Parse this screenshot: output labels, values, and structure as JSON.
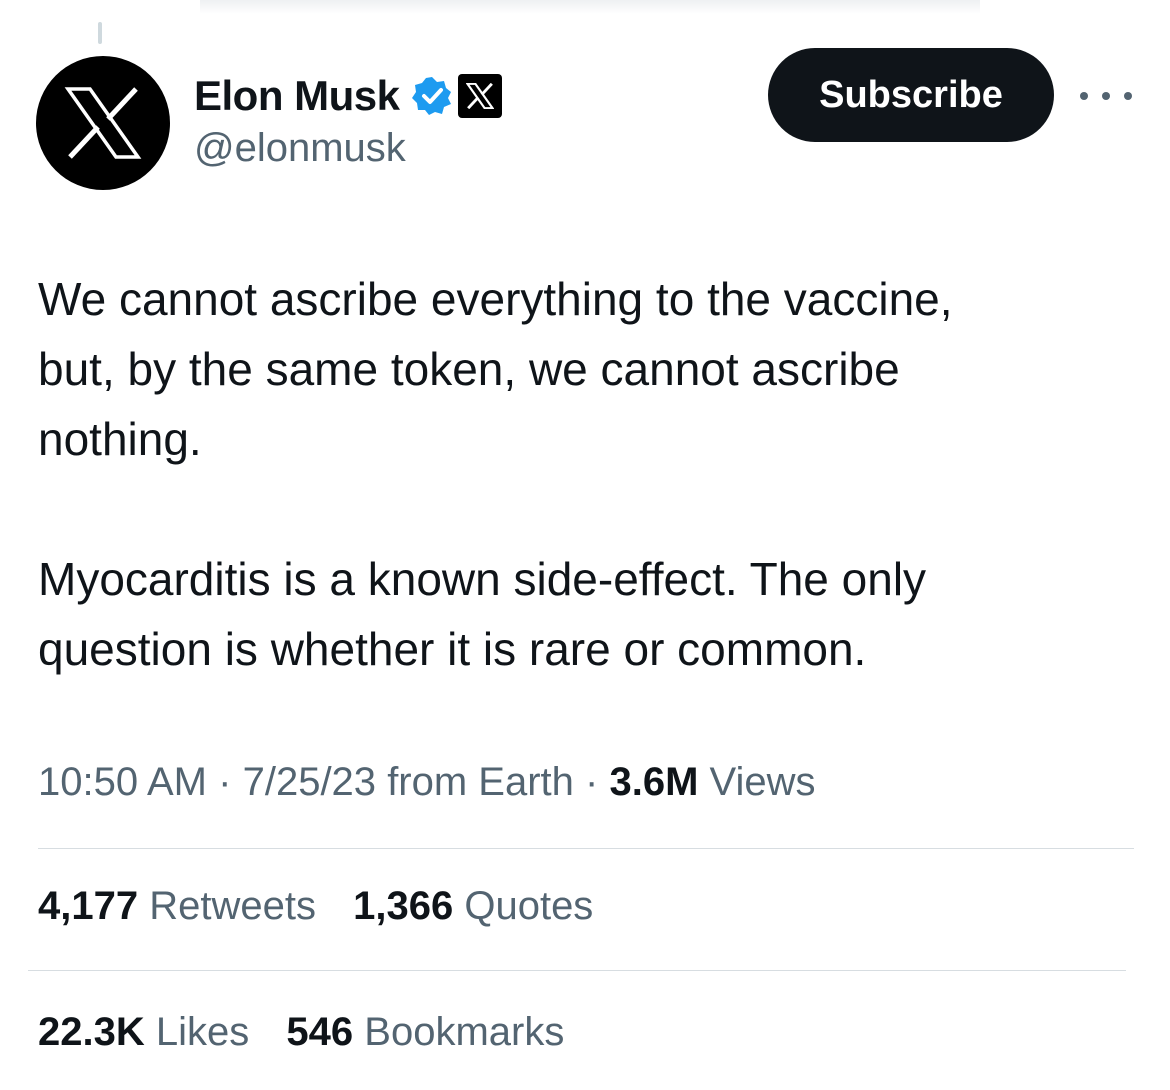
{
  "author": {
    "display_name": "Elon Musk",
    "handle": "@elonmusk",
    "avatar_icon": "x-logo-icon",
    "verified_icon": "verified-badge-icon",
    "affiliation_icon": "x-affiliate-badge-icon"
  },
  "actions": {
    "subscribe_label": "Subscribe",
    "more_icon": "more-options-icon"
  },
  "tweet": {
    "paragraph_1": "We cannot ascribe everything to the vaccine,\nbut, by the same token, we cannot ascribe\nnothing.",
    "paragraph_2": "Myocarditis is a known side-effect. The only\nquestion is whether it is rare or common."
  },
  "meta": {
    "time": "10:50 AM",
    "separator": "·",
    "date": "7/25/23",
    "source": "from Earth",
    "views_count": "3.6M",
    "views_label": "Views"
  },
  "stats": {
    "retweets_count": "4,177",
    "retweets_label": "Retweets",
    "quotes_count": "1,366",
    "quotes_label": "Quotes",
    "likes_count": "22.3K",
    "likes_label": "Likes",
    "bookmarks_count": "546",
    "bookmarks_label": "Bookmarks"
  },
  "colors": {
    "text_primary": "#0f1419",
    "text_secondary": "#536471",
    "verified_blue": "#1d9bf0",
    "button_bg": "#0f1419",
    "divider": "#d7dde1"
  }
}
